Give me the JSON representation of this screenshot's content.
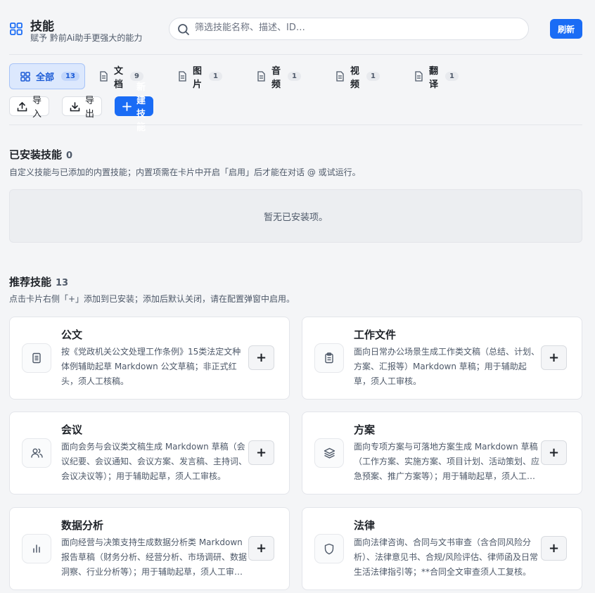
{
  "header": {
    "title": "技能",
    "subtitle": "赋予 黔前Ai助手更强大的能力",
    "app_icon": "grid-icon"
  },
  "search": {
    "placeholder": "筛选技能名称、描述、ID…",
    "value": ""
  },
  "refresh_label": "刷新",
  "tabs": [
    {
      "label": "全部",
      "count": "13",
      "icon": "grid-icon",
      "active": true
    },
    {
      "label": "文档",
      "count": "9",
      "icon": "document-icon",
      "active": false
    },
    {
      "label": "图片",
      "count": "1",
      "icon": "document-icon",
      "active": false
    },
    {
      "label": "音频",
      "count": "1",
      "icon": "document-icon",
      "active": false
    },
    {
      "label": "视频",
      "count": "1",
      "icon": "document-icon",
      "active": false
    },
    {
      "label": "翻译",
      "count": "1",
      "icon": "document-icon",
      "active": false
    }
  ],
  "toolbar": {
    "import_label": "导入",
    "export_label": "导出",
    "new_label": "新建技能"
  },
  "installed": {
    "title": "已安装技能",
    "count": "0",
    "desc": "自定义技能与已添加的内置技能；内置项需在卡片中开启「启用」后才能在对话 @ 或试运行。",
    "empty_text": "暂无已安装项。"
  },
  "recommended": {
    "title": "推荐技能",
    "count": "13",
    "desc": "点击卡片右侧「+」添加到已安装；添加后默认关闭，请在配置弹窗中启用。",
    "add_label": "+",
    "cards": [
      {
        "title": "公文",
        "icon": "document-icon",
        "desc": "按《党政机关公文处理工作条例》15类法定文种体例辅助起草 Markdown 公文草稿；非正式红头，须人工核稿。"
      },
      {
        "title": "工作文件",
        "icon": "clipboard-icon",
        "desc": "面向日常办公场景生成工作类文稿（总结、计划、方案、汇报等）Markdown 草稿；用于辅助起草，须人工审核。"
      },
      {
        "title": "会议",
        "icon": "users-icon",
        "desc": "面向会务与会议类文稿生成 Markdown 草稿（会议纪要、会议通知、会议方案、发言稿、主持词、会议决议等）；用于辅助起草，须人工审核。"
      },
      {
        "title": "方案",
        "icon": "layers-icon",
        "desc": "面向专项方案与可落地方案生成 Markdown 草稿（工作方案、实施方案、项目计划、活动策划、应急预案、推广方案等）；用于辅助起草，须人工审核。"
      },
      {
        "title": "数据分析",
        "icon": "bar-chart-icon",
        "desc": "面向经营与决策支持生成数据分析类 Markdown 报告草稿（财务分析、经营分析、市场调研、数据洞察、行业分析等）；用于辅助起草，须人工审核。"
      },
      {
        "title": "法律",
        "icon": "shield-icon",
        "desc": "面向法律咨询、合同与文书审查（含合同风险分析）、法律意见书、合规/风险评估、律师函及日常生活法律指引等；**合同全文审查须人工复核。"
      }
    ]
  }
}
